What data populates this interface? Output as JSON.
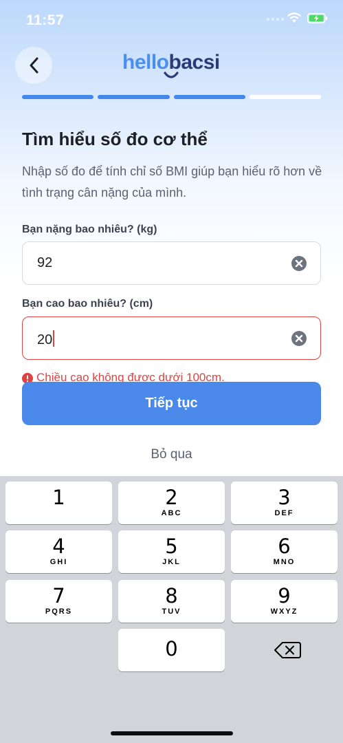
{
  "status_bar": {
    "time": "11:57"
  },
  "header": {
    "back_icon": "chevron-left-icon",
    "logo_part1": "hello",
    "logo_part2": "bacsi"
  },
  "progress": {
    "total_steps": 4,
    "active_steps": 3
  },
  "page": {
    "title": "Tìm hiểu số đo cơ thể",
    "subtitle": "Nhập số đo để tính chỉ số BMI giúp bạn hiểu rõ hơn về tình trạng cân nặng của mình."
  },
  "weight_field": {
    "label": "Bạn nặng bao nhiêu? (kg)",
    "value": "92"
  },
  "height_field": {
    "label": "Bạn cao bao nhiêu? (cm)",
    "value": "20",
    "error": "Chiều cao không được dưới 100cm."
  },
  "actions": {
    "continue_label": "Tiếp tục",
    "skip_label": "Bỏ qua"
  },
  "keyboard": {
    "keys": [
      {
        "digit": "1",
        "letters": ""
      },
      {
        "digit": "2",
        "letters": "ABC"
      },
      {
        "digit": "3",
        "letters": "DEF"
      },
      {
        "digit": "4",
        "letters": "GHI"
      },
      {
        "digit": "5",
        "letters": "JKL"
      },
      {
        "digit": "6",
        "letters": "MNO"
      },
      {
        "digit": "7",
        "letters": "PQRS"
      },
      {
        "digit": "8",
        "letters": "TUV"
      },
      {
        "digit": "9",
        "letters": "WXYZ"
      },
      {
        "digit": "0",
        "letters": ""
      }
    ],
    "delete_icon": "backspace-icon"
  },
  "colors": {
    "accent": "#4a88ea",
    "error": "#de4343",
    "logo_dark": "#2a3c78"
  }
}
